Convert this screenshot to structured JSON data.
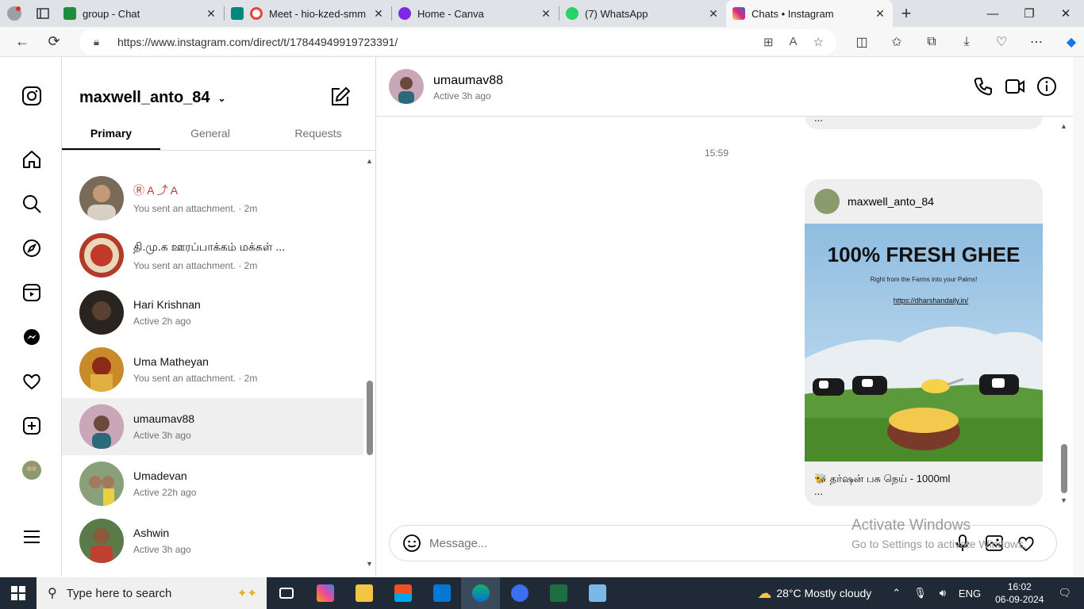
{
  "browser": {
    "tabs": [
      {
        "title": "group - Chat",
        "color": "#1e8e3e"
      },
      {
        "title": "Meet - hio-kzed-smm",
        "color": "#ea4335"
      },
      {
        "title": "Home - Canva",
        "color": "#7d2ae8"
      },
      {
        "title": "(7) WhatsApp",
        "color": "#25d366"
      },
      {
        "title": "Chats • Instagram",
        "color": "#d62976"
      }
    ],
    "url": "https://www.instagram.com/direct/t/17844949919723391/"
  },
  "inbox": {
    "username": "maxwell_anto_84",
    "tabs": [
      "Primary",
      "General",
      "Requests"
    ],
    "conversations": [
      {
        "name": "Ⓡ A ⤴ A",
        "sub": "You sent an attachment. · 2m",
        "color": "#7a6a5a"
      },
      {
        "name": "தி.மு.க ஊரப்பாக்கம் மக்கள் ...",
        "sub": "You sent an attachment. · 2m",
        "color": "#b33a2a"
      },
      {
        "name": "Hari Krishnan",
        "sub": "Active 2h ago",
        "color": "#2a2420"
      },
      {
        "name": "Uma Matheyan",
        "sub": "You sent an attachment. · 2m",
        "color": "#c98a2a"
      },
      {
        "name": "umaumav88",
        "sub": "Active 3h ago",
        "color": "#b07a8a"
      },
      {
        "name": "Umadevan",
        "sub": "Active 22h ago",
        "color": "#8aa07a"
      },
      {
        "name": "Ashwin",
        "sub": "Active 3h ago",
        "color": "#5a7a4a"
      }
    ]
  },
  "chat": {
    "name": "umaumav88",
    "status": "Active 3h ago",
    "time": "15:59",
    "prev_more": "...",
    "post": {
      "sender": "maxwell_anto_84",
      "headline": "100% FRESH GHEE",
      "tagline": "Right from the Farms into your Palms!",
      "link": "https://dharshandaily.in/",
      "caption": "🐝 தர்ஷன் பசு நெய் - 1000ml",
      "more": "..."
    },
    "message_placeholder": "Message..."
  },
  "watermark": {
    "line1": "Activate Windows",
    "line2": "Go to Settings to activate Windows."
  },
  "taskbar": {
    "search_placeholder": "Type here to search",
    "weather": "28°C  Mostly cloudy",
    "lang": "ENG",
    "time": "16:02",
    "date": "06-09-2024"
  }
}
